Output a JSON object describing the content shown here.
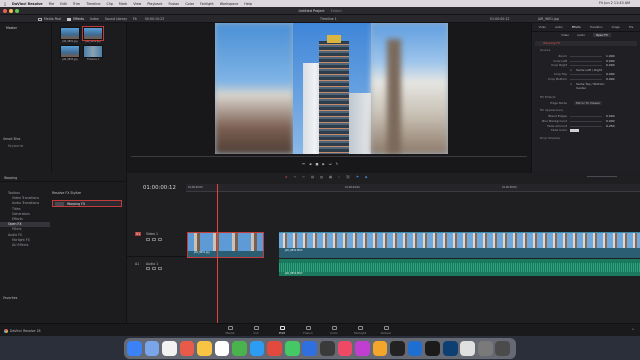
{
  "menubar": {
    "app": "DaVinci Resolve",
    "items": [
      "File",
      "Edit",
      "Trim",
      "Timeline",
      "Clip",
      "Mark",
      "View",
      "Playback",
      "Fusion",
      "Color",
      "Fairlight",
      "Workspace",
      "Help"
    ],
    "clock": "Fri Jun 2  11:43 AM"
  },
  "titlebar": {
    "project": "Untitled Project",
    "status": "Edited"
  },
  "toolbar": {
    "media_pool": "Media Pool",
    "effects": "Effects",
    "index": "Index",
    "sound_library": "Sound Library",
    "zoom": "Fit",
    "timecode_left": "00:00:10:23",
    "timeline_name": "Timeline 1",
    "timecode_right": "01:00:00:12",
    "clip_name": "JAR_9851.jpg"
  },
  "mediapool": {
    "master": "Master",
    "thumbs": [
      {
        "label": "JAR_9851.jpg",
        "selected": false
      },
      {
        "label": "JAR_9852.jpg",
        "selected": true
      },
      {
        "label": "JAR_9853.jpg",
        "selected": false
      },
      {
        "label": "Timeline 1",
        "selected": false
      }
    ],
    "smart_bins": "Smart Bins",
    "keywords": "Keywords"
  },
  "viewer": {
    "timecode": "01:00:00:12"
  },
  "inspector": {
    "tabs": [
      "Video",
      "Audio",
      "Effects",
      "Transition",
      "Image",
      "File"
    ],
    "active_tab": "Effects",
    "subtabs": [
      "Video",
      "Audio",
      "Open FX"
    ],
    "active_subtab": "Open FX",
    "plugin": "Warping FX",
    "section_source": "Source",
    "rows": [
      {
        "label": "Zoom",
        "value": "1.000"
      },
      {
        "label": "Crop Left",
        "value": "0.000"
      },
      {
        "label": "Crop Right",
        "value": "0.000"
      },
      {
        "label": "Crop Top",
        "value": "0.000"
      },
      {
        "label": "Crop Bottom",
        "value": "0.000"
      }
    ],
    "options": [
      "Same Left / Right",
      "Same Top / Bottom",
      "Center"
    ],
    "section_fill": "Fill Extend",
    "edge_mode_label": "Edge Mode",
    "edge_mode": "Mirror To Viewer",
    "section_appearance": "Fill Appearance",
    "appearance_rows": [
      {
        "label": "Blend Edges",
        "value": "0.000"
      },
      {
        "label": "Blur Background",
        "value": "0.000"
      },
      {
        "label": "Fade Amount",
        "value": "0.250"
      }
    ],
    "fade_color_label": "Fade Color",
    "section_shadow": "Drop Shadow"
  },
  "effects": {
    "header": "Toolbox",
    "tree": [
      "Toolbox",
      "Video Transitions",
      "Audio Transitions",
      "Titles",
      "Generators",
      "Effects",
      "Open FX",
      "Filters",
      "Audio FX",
      "Fairlight FX",
      "AU Effects",
      "Favorites"
    ],
    "selected_tree": "Open FX",
    "category": "Resolve FX Stylize",
    "effect_item": "Warping FX",
    "panel_title": "Warping"
  },
  "timeline": {
    "timecode": "01:00:00:12",
    "ruler": [
      "01:00:00:00",
      "01:00:04:00",
      "01:00:08:00"
    ],
    "video_track": "Video 1",
    "audio_track": "Audio 1",
    "v_label": "V1",
    "a_label": "A1",
    "clip_first": "JAR_9851.jpg",
    "clip_second": "JAR_9852.MOV",
    "audio_clip": "JAR_9852.MOV"
  },
  "pages": [
    "Media",
    "Cut",
    "Edit",
    "Fusion",
    "Color",
    "Fairlight",
    "Deliver"
  ],
  "active_page": "Edit",
  "footer_app": "DaVinci Resolve 18",
  "dock_colors": [
    "#3b82f6",
    "#7aa5e8",
    "#f2f2f2",
    "#e85b4a",
    "#f7c444",
    "#ffffff",
    "#4bb34e",
    "#2d9df4",
    "#e24a3f",
    "#45c866",
    "#2f6fe0",
    "#3a3a3a",
    "#ef4966",
    "#c03fd0",
    "#f4a52b",
    "#222222",
    "#1f6fd2",
    "#1b1b1b",
    "#0d3f73",
    "#e0e0e0",
    "#7a7a7a",
    "#4b4b4b"
  ]
}
